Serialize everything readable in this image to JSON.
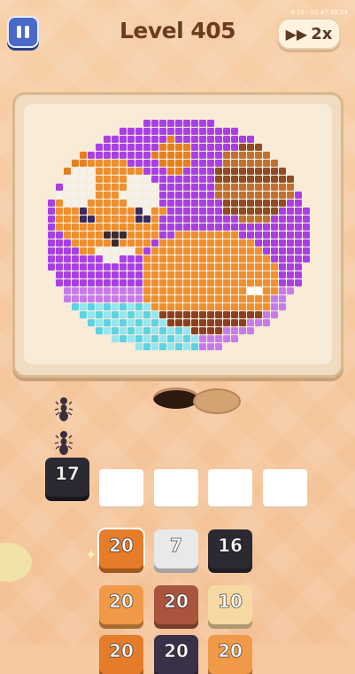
{
  "header": {
    "level_label": "Level 405",
    "speed_label": "2x",
    "speed_icon": "fast-forward-icon",
    "pause_icon": "pause-icon",
    "status_text": "4:15 · 10:47 35:14"
  },
  "colors": {
    "board_bg": "#f8ebd8",
    "accent_blue": "#4a69c9",
    "title_brown": "#6b3d1c"
  },
  "queue": {
    "active_tile": {
      "value": "17",
      "color": "#2b2a33"
    },
    "empty_slots": 4
  },
  "tiles": [
    {
      "value": "20",
      "color": "#e57c2a",
      "selected": true
    },
    {
      "value": "7",
      "color": "#e9e9ea"
    },
    {
      "value": "16",
      "color": "#2b2a33"
    },
    {
      "value": "20",
      "color": "#f09a48"
    },
    {
      "value": "20",
      "color": "#a9543d"
    },
    {
      "value": "10",
      "color": "#f8d8a2"
    },
    {
      "value": "20",
      "color": "#e57c2a"
    },
    {
      "value": "20",
      "color": "#3a3048"
    },
    {
      "value": "20",
      "color": "#f09a48"
    }
  ],
  "ants_count": 2
}
